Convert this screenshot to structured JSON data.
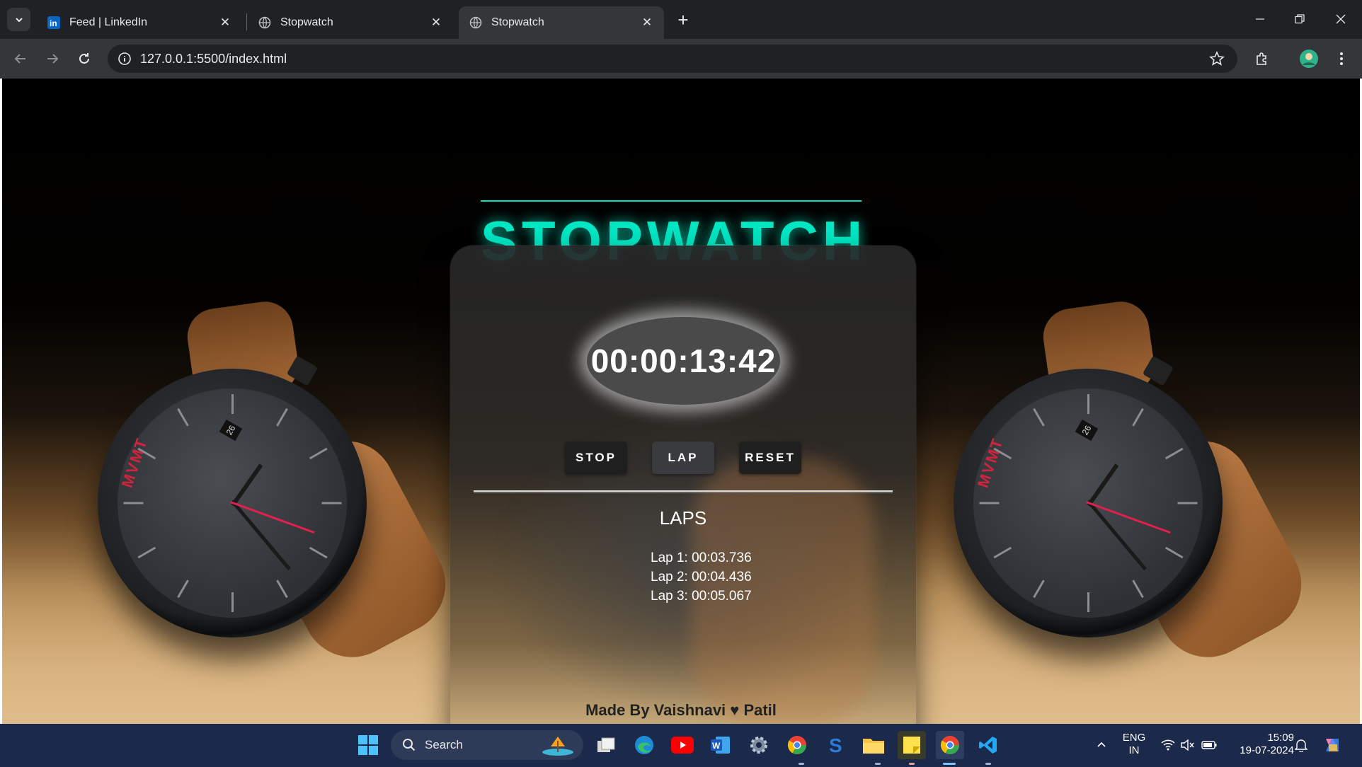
{
  "browser": {
    "tabs": [
      {
        "title": "Feed | LinkedIn",
        "favicon": "linkedin-icon",
        "active": false
      },
      {
        "title": "Stopwatch",
        "favicon": "globe-icon",
        "active": false
      },
      {
        "title": "Stopwatch",
        "favicon": "globe-icon",
        "active": true
      }
    ],
    "address": "127.0.0.1:5500/index.html"
  },
  "page": {
    "heading": "STOPWATCH",
    "time_display": "00:00:13:42",
    "buttons": {
      "stop": "STOP",
      "lap": "LAP",
      "reset": "RESET"
    },
    "laps_title": "LAPS",
    "laps": [
      "Lap 1: 00:03.736",
      "Lap 2: 00:04.436",
      "Lap 3: 00:05.067"
    ],
    "footer": "Made By Vaishnavi ♥ Patil",
    "watch_brand": "MVMT",
    "watch_date": "26"
  },
  "taskbar": {
    "search_label": "Search",
    "apps": [
      "windows-start-icon",
      "task-view-icon",
      "edge-icon",
      "youtube-icon",
      "word-icon",
      "settings-icon",
      "chrome-canary-icon",
      "skype-icon",
      "file-explorer-icon",
      "sticky-notes-icon",
      "chrome-icon",
      "vscode-icon"
    ],
    "language_line1": "ENG",
    "language_line2": "IN",
    "time": "15:09",
    "date": "19-07-2024"
  },
  "colors": {
    "accent": "#00e6c3",
    "taskbar": "#1b2a4a",
    "chrome_dark": "#202124",
    "chrome_toolbar": "#35363a"
  }
}
